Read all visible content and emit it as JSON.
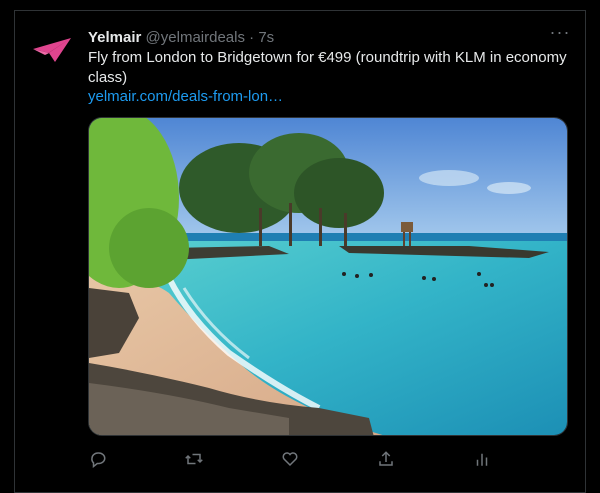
{
  "tweet": {
    "author_name": "Yelmair",
    "author_handle": "@yelmairdeals",
    "separator": "·",
    "time": "7s",
    "text": "Fly from London to Bridgetown for €499 (roundtrip with KLM in economy class)",
    "link": "yelmair.com/deals-from-lon…",
    "more_label": "···"
  },
  "media": {
    "icon": "beach-photo"
  },
  "actions": {
    "reply_icon": "reply-icon",
    "retweet_icon": "retweet-icon",
    "like_icon": "heart-icon",
    "share_icon": "share-icon",
    "analytics_icon": "analytics-icon"
  },
  "colors": {
    "background": "#000000",
    "text": "#e7e9ea",
    "muted": "#71767b",
    "link": "#1d9bf0",
    "brand": "#e0458f"
  }
}
